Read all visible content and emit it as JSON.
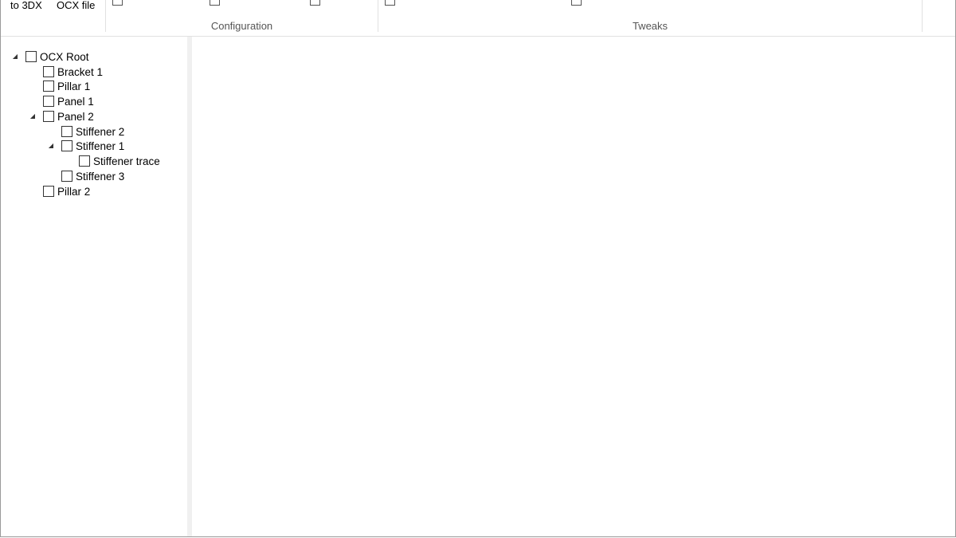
{
  "ribbon": {
    "buttons": [
      {
        "label": "to 3DX",
        "icon": "export-3dx-icon"
      },
      {
        "label": "OCX file",
        "icon": "ocx-file-icon"
      }
    ],
    "groups": [
      {
        "label": "Configuration"
      },
      {
        "label": "Tweaks"
      }
    ]
  },
  "tree": {
    "nodes": [
      {
        "label": "OCX Root",
        "level": 0,
        "expanded": true,
        "checked": false
      },
      {
        "label": "Bracket 1",
        "level": 1,
        "expanded": null,
        "checked": false
      },
      {
        "label": "Pillar 1",
        "level": 1,
        "expanded": null,
        "checked": false
      },
      {
        "label": "Panel 1",
        "level": 1,
        "expanded": null,
        "checked": false
      },
      {
        "label": "Panel 2",
        "level": 1,
        "expanded": true,
        "checked": false
      },
      {
        "label": "Stiffener 2",
        "level": 2,
        "expanded": null,
        "checked": false
      },
      {
        "label": "Stiffener 1",
        "level": 2,
        "expanded": true,
        "checked": false
      },
      {
        "label": "Stiffener trace",
        "level": 3,
        "expanded": null,
        "checked": false
      },
      {
        "label": "Stiffener 3",
        "level": 2,
        "expanded": null,
        "checked": false
      },
      {
        "label": "Pillar 2",
        "level": 1,
        "expanded": null,
        "checked": false
      }
    ]
  },
  "colors": {
    "border": "#9a9a9a",
    "splitter": "#f0f0f0",
    "group_label": "#555555"
  }
}
